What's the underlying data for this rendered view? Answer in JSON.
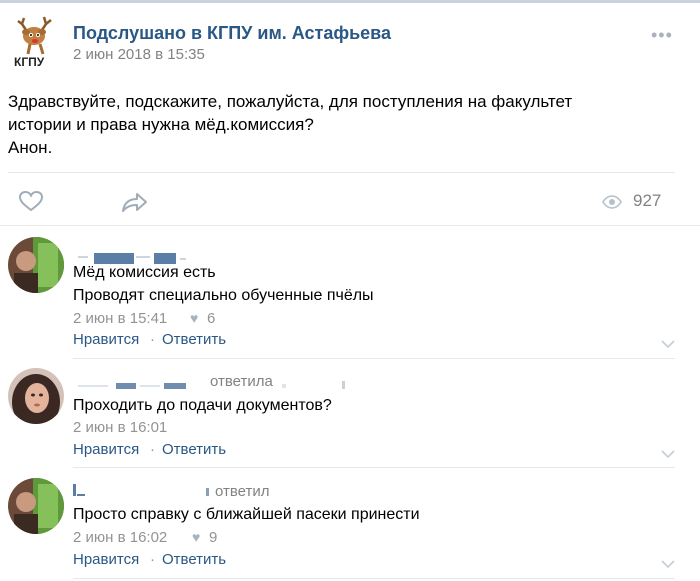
{
  "post": {
    "group_name": "Подслушано в КГПУ им. Астафьева",
    "time": "2 июн 2018 в 15:35",
    "logo_text": "КГПУ",
    "lines": [
      "Здравствуйте, подскажите, пожалуйста, для поступления на факультет",
      "истории и права нужна мёд.комиссия?",
      "Анон."
    ],
    "views": "927"
  },
  "comments": [
    {
      "lines": [
        "Мёд комиссия есть",
        "Проводят специально обученные пчёлы"
      ],
      "time": "2 июн в 15:41",
      "likes": "6",
      "like_label": "Нравится",
      "reply_label": "Ответить"
    },
    {
      "reply_to": "ответила",
      "lines": [
        "Проходить до подачи документов?"
      ],
      "time": "2 июн в 16:01",
      "like_label": "Нравится",
      "reply_label": "Ответить"
    },
    {
      "reply_to": "ответил",
      "lines": [
        "Просто справку с ближайшей пасеки принести"
      ],
      "time": "2 июн в 16:02",
      "likes": "9",
      "like_label": "Нравится",
      "reply_label": "Ответить"
    }
  ],
  "colors": {
    "link": "#2a5885",
    "muted": "#828282",
    "divider": "#e7e8ec"
  },
  "icons": [
    "deer-logo",
    "more-icon",
    "heart-icon",
    "share-icon",
    "eye-icon",
    "chevron-down-icon"
  ]
}
